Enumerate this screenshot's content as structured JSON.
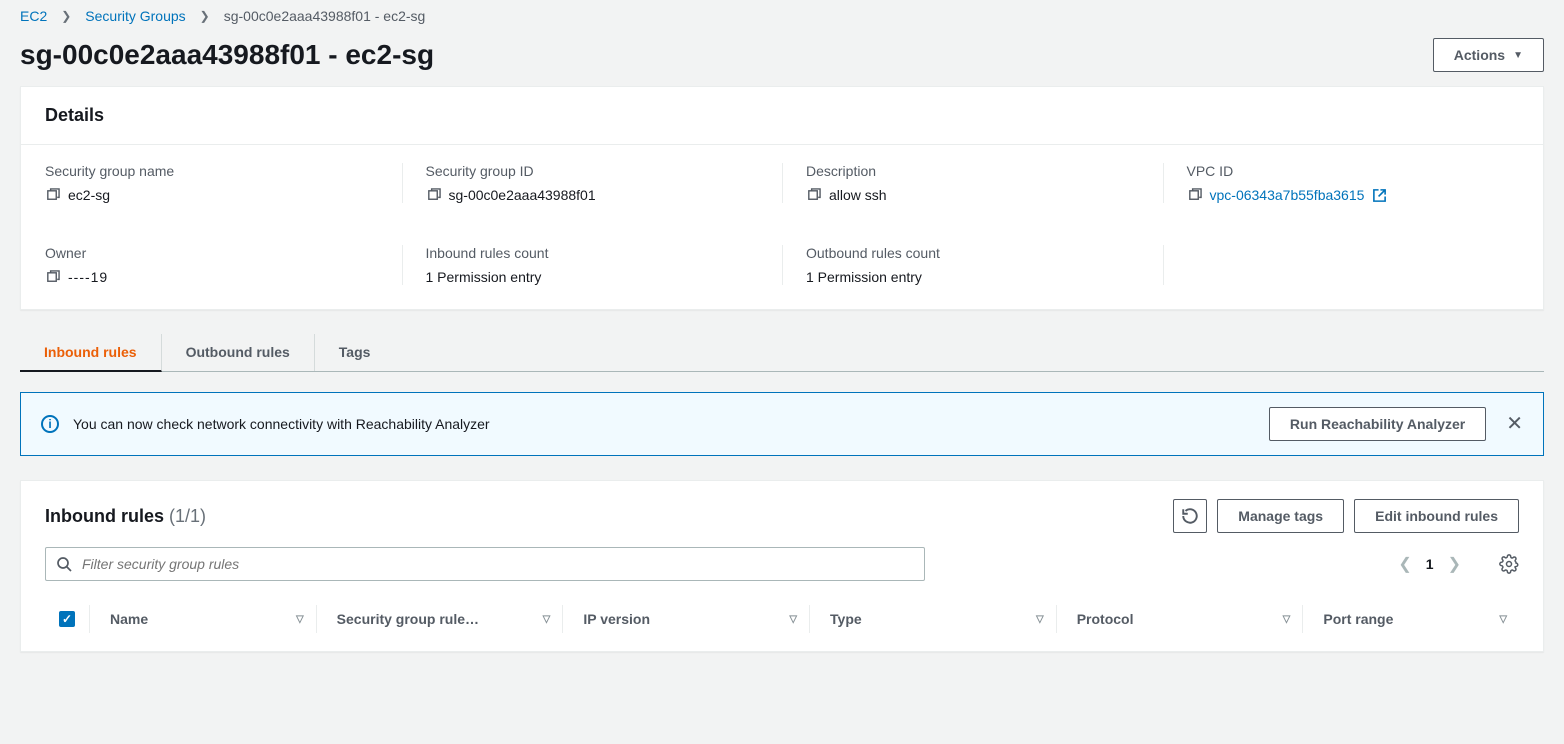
{
  "breadcrumb": {
    "root": "EC2",
    "mid": "Security Groups",
    "current": "sg-00c0e2aaa43988f01 - ec2-sg"
  },
  "header": {
    "title": "sg-00c0e2aaa43988f01 - ec2-sg",
    "actions_label": "Actions"
  },
  "details": {
    "panel_title": "Details",
    "fields": {
      "sg_name": {
        "label": "Security group name",
        "value": "ec2-sg"
      },
      "sg_id": {
        "label": "Security group ID",
        "value": "sg-00c0e2aaa43988f01"
      },
      "description": {
        "label": "Description",
        "value": "allow ssh"
      },
      "vpc_id": {
        "label": "VPC ID",
        "value": "vpc-06343a7b55fba3615"
      },
      "owner": {
        "label": "Owner",
        "value": "----19"
      },
      "inbound_count": {
        "label": "Inbound rules count",
        "value": "1 Permission entry"
      },
      "outbound_count": {
        "label": "Outbound rules count",
        "value": "1 Permission entry"
      }
    }
  },
  "tabs": {
    "inbound": "Inbound rules",
    "outbound": "Outbound rules",
    "tags": "Tags"
  },
  "info_banner": {
    "text": "You can now check network connectivity with Reachability Analyzer",
    "button": "Run Reachability Analyzer"
  },
  "rules": {
    "title": "Inbound rules",
    "count": "(1/1)",
    "manage_tags": "Manage tags",
    "edit_rules": "Edit inbound rules",
    "filter_placeholder": "Filter security group rules",
    "page": "1",
    "columns": {
      "name": "Name",
      "sg_rule": "Security group rule…",
      "ip_version": "IP version",
      "type": "Type",
      "protocol": "Protocol",
      "port_range": "Port range"
    }
  }
}
